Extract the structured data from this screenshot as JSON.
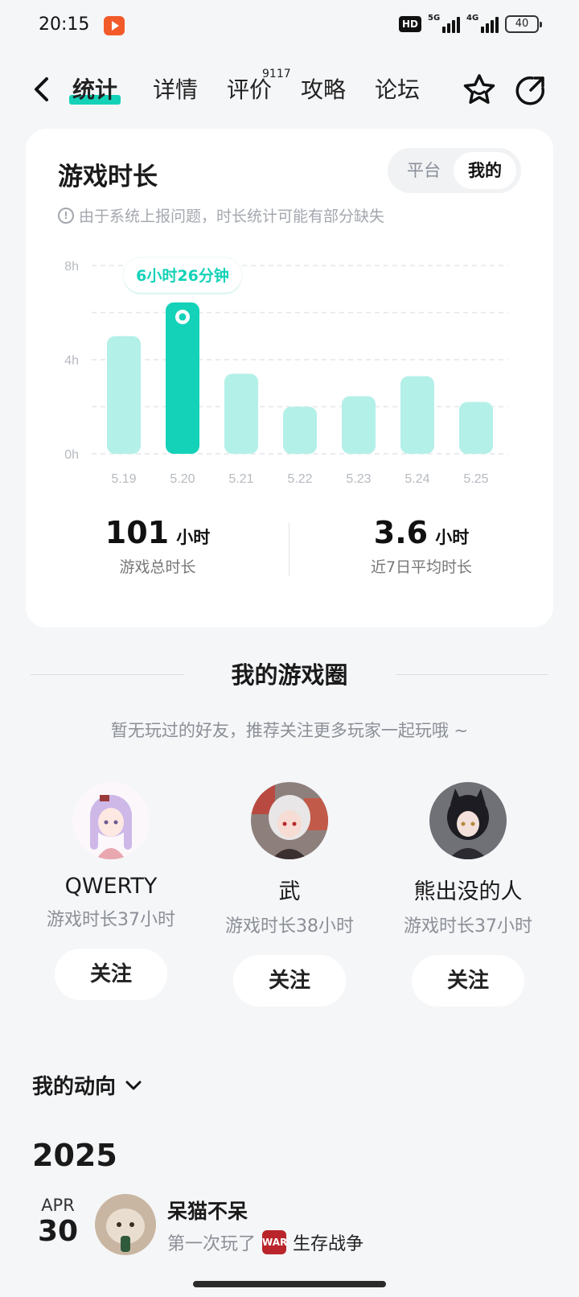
{
  "status_bar": {
    "time": "20:15",
    "hd": "HD",
    "net1": "5G",
    "net2": "4G",
    "battery": "40"
  },
  "nav": {
    "tabs": [
      {
        "label": "统计"
      },
      {
        "label": "详情"
      },
      {
        "label": "评价"
      },
      {
        "label": "攻略"
      },
      {
        "label": "论坛"
      }
    ],
    "review_count": "9117",
    "accent_color": "#14d2b8"
  },
  "stats_card": {
    "title": "游戏时长",
    "toggle": [
      "平台",
      "我的"
    ],
    "selected_toggle": "我的",
    "notice": "由于系统上报问题，时长统计可能有部分缺失",
    "total_value": "101",
    "total_unit": "小时",
    "total_label": "游戏总时长",
    "avg_value": "3.6",
    "avg_unit": "小时",
    "avg_label": "近7日平均时长"
  },
  "chart_data": {
    "type": "bar",
    "categories": [
      "5.19",
      "5.20",
      "5.21",
      "5.22",
      "5.23",
      "5.24",
      "5.25"
    ],
    "values": [
      5.0,
      6.43,
      3.4,
      2.0,
      2.45,
      3.3,
      2.2
    ],
    "y_ticks": [
      "0h",
      "4h",
      "8h"
    ],
    "ylim": [
      0,
      8
    ],
    "highlight_index": 1,
    "highlight_label": "6小时26分钟",
    "bar_color": "#b3f0e8",
    "highlight_color": "#14d2b8",
    "grid": true
  },
  "game_circle": {
    "title": "我的游戏圈",
    "subtitle": "暂无玩过的好友，推荐关注更多玩家一起玩哦 ~",
    "friends": [
      {
        "name": "QWERTY",
        "playtime": "游戏时长37小时",
        "follow": "关注"
      },
      {
        "name": "武",
        "playtime": "游戏时长38小时",
        "follow": "关注"
      },
      {
        "name": "熊出没的人",
        "playtime": "游戏时长37小时",
        "follow": "关注"
      }
    ]
  },
  "activity": {
    "heading": "我的动向",
    "year": "2025",
    "entries": [
      {
        "month": "APR",
        "day": "30",
        "user": "呆猫不呆",
        "action": "第一次玩了",
        "game_icon_text": "WAR",
        "game": "生存战争"
      }
    ]
  }
}
